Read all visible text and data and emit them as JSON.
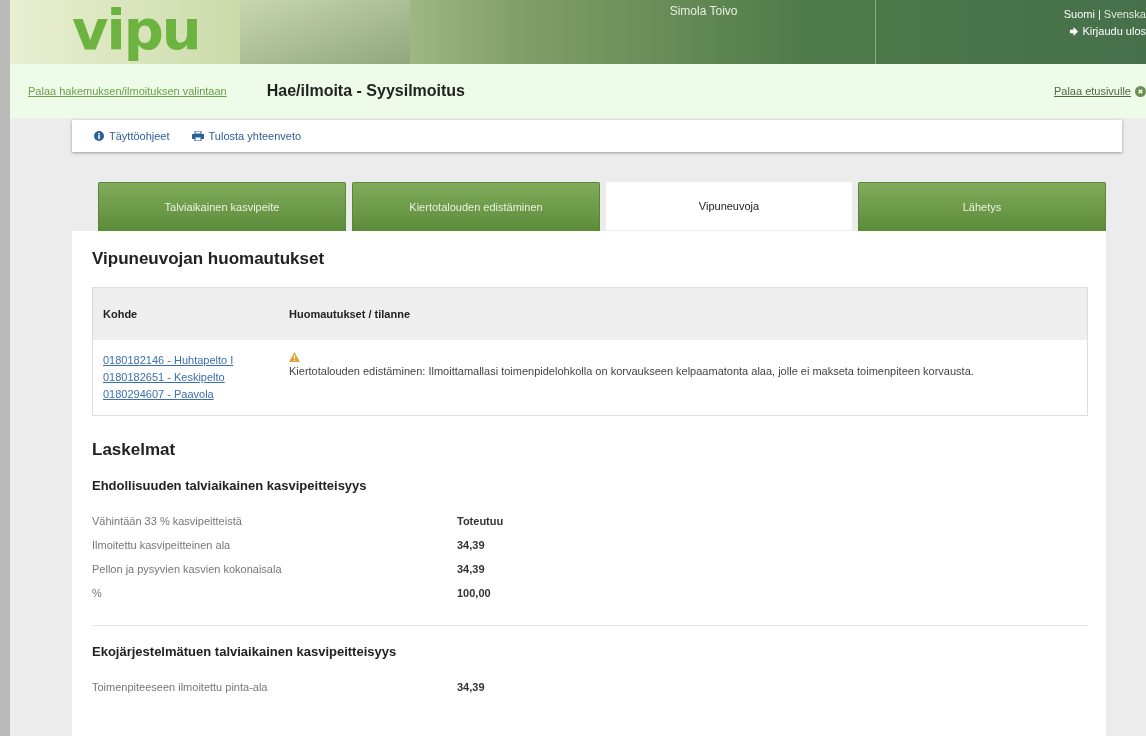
{
  "header": {
    "logo": "vipu",
    "user": "Simola Toivo",
    "languages": [
      {
        "label": "Suomi",
        "selected": true
      },
      {
        "label": "Svenska",
        "selected": false
      }
    ],
    "separator": "|",
    "logout": "Kirjaudu ulos"
  },
  "breadcrumb": {
    "back_link": "Palaa hakemuksen/ilmoituksen valintaan",
    "title": "Hae/ilmoita - Syysilmoitus",
    "home_link": "Palaa etusivulle"
  },
  "toolbar": [
    {
      "kind": "info",
      "label": "Täyttöohjeet"
    },
    {
      "kind": "print",
      "label": "Tulosta yhteenveto"
    }
  ],
  "tabs": [
    {
      "label": "Talviaikainen kasvipeite",
      "selected": false
    },
    {
      "label": "Kiertotalouden edistäminen",
      "selected": false
    },
    {
      "label": "Vipuneuvoja",
      "selected": true
    },
    {
      "label": "Lähetys",
      "selected": false
    }
  ],
  "notes": {
    "title": "Vipuneuvojan huomautukset",
    "columns": [
      "Kohde",
      "Huomautukset / tilanne"
    ],
    "rows": [
      {
        "targets": [
          "0180182146 - Huhtapelto I",
          "0180182651 - Keskipelto",
          "0180294607 - Paavola"
        ],
        "kind": "warning",
        "message": "Kiertotalouden edistäminen: Ilmoittamallasi toimenpidelohkolla on korvaukseen kelpaamatonta alaa, jolle ei makseta toimenpiteen korvausta."
      }
    ]
  },
  "calculations": {
    "title": "Laskelmat",
    "sections": [
      {
        "title": "Ehdollisuuden talviaikainen kasvipeitteisyys",
        "rows": [
          {
            "label": "Vähintään 33 % kasvipeitteistä",
            "value": "Toteutuu"
          },
          {
            "label": "Ilmoitettu kasvipeitteinen ala",
            "value": "34,39"
          },
          {
            "label": "Pellon ja pysyvien kasvien kokonaisala",
            "value": "34,39"
          },
          {
            "label": "%",
            "value": "100,00"
          }
        ]
      },
      {
        "title": "Ekojärjestelmätuen talviaikainen kasvipeitteisyys",
        "rows": [
          {
            "label": "Toimenpiteeseen ilmoitettu pinta-ala",
            "value": "34,39"
          }
        ]
      }
    ]
  }
}
